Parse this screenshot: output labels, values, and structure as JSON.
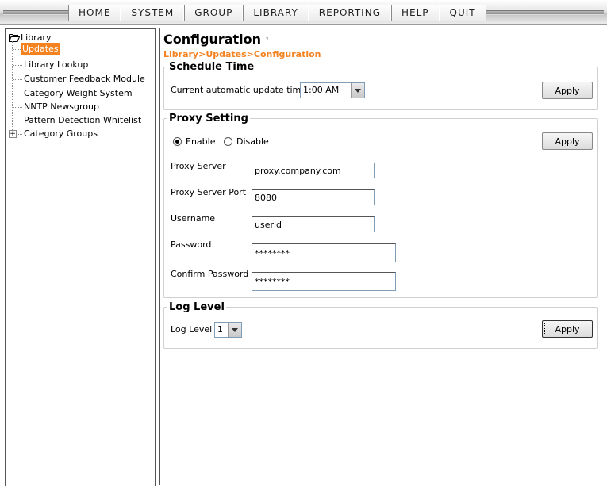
{
  "menu": [
    "HOME",
    "SYSTEM",
    "GROUP",
    "LIBRARY",
    "REPORTING",
    "HELP",
    "QUIT"
  ],
  "tree": {
    "root": "Library",
    "items": [
      {
        "label": "Updates",
        "selected": true
      },
      {
        "label": "Library Lookup"
      },
      {
        "label": "Customer Feedback Module"
      },
      {
        "label": "Category Weight System"
      },
      {
        "label": "NNTP Newsgroup"
      },
      {
        "label": "Pattern Detection Whitelist"
      },
      {
        "label": "Category Groups",
        "expandable": true
      }
    ]
  },
  "page": {
    "title": "Configuration",
    "breadcrumb": "Library>Updates>Configuration"
  },
  "schedule": {
    "legend": "Schedule Time",
    "label": "Current automatic update time:",
    "time": "1:00 AM",
    "apply": "Apply"
  },
  "proxy": {
    "legend": "Proxy Setting",
    "enable": "Enable",
    "disable": "Disable",
    "enabled": true,
    "apply": "Apply",
    "server_label": "Proxy Server",
    "server": "proxy.company.com",
    "port_label": "Proxy Server Port",
    "port": "8080",
    "user_label": "Username",
    "user": "userid",
    "pass_label": "Password",
    "pass": "********",
    "confirm_label": "Confirm Password",
    "confirm": "********"
  },
  "log": {
    "legend": "Log Level",
    "label": "Log Level",
    "level": "1",
    "apply": "Apply"
  }
}
